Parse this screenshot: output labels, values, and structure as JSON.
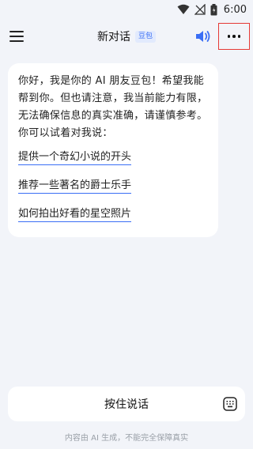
{
  "status_bar": {
    "time": "6:00",
    "icons": [
      "wifi-icon",
      "no-signal-icon",
      "battery-icon"
    ]
  },
  "header": {
    "title": "新对话",
    "badge": "豆包",
    "icons": [
      "menu-icon",
      "speaker-icon",
      "more-icon"
    ]
  },
  "message": {
    "text": "你好，我是你的 AI 朋友豆包！希望我能帮到你。但也请注意，我当前能力有限，无法确保信息的真实准确，请谨慎参考。你可以试着对我说：",
    "suggestions": [
      "提供一个奇幻小说的开头",
      "推荐一些著名的爵士乐手",
      "如何拍出好看的星空照片"
    ]
  },
  "input": {
    "hold_to_talk_label": "按住说话",
    "keyboard_icon": "keyboard-icon"
  },
  "footer": {
    "disclaimer": "内容由 AI 生成，不能完全保障真实"
  },
  "colors": {
    "accent": "#3a6ef5",
    "highlight_border": "#e53935",
    "background": "#f2f4f9"
  }
}
